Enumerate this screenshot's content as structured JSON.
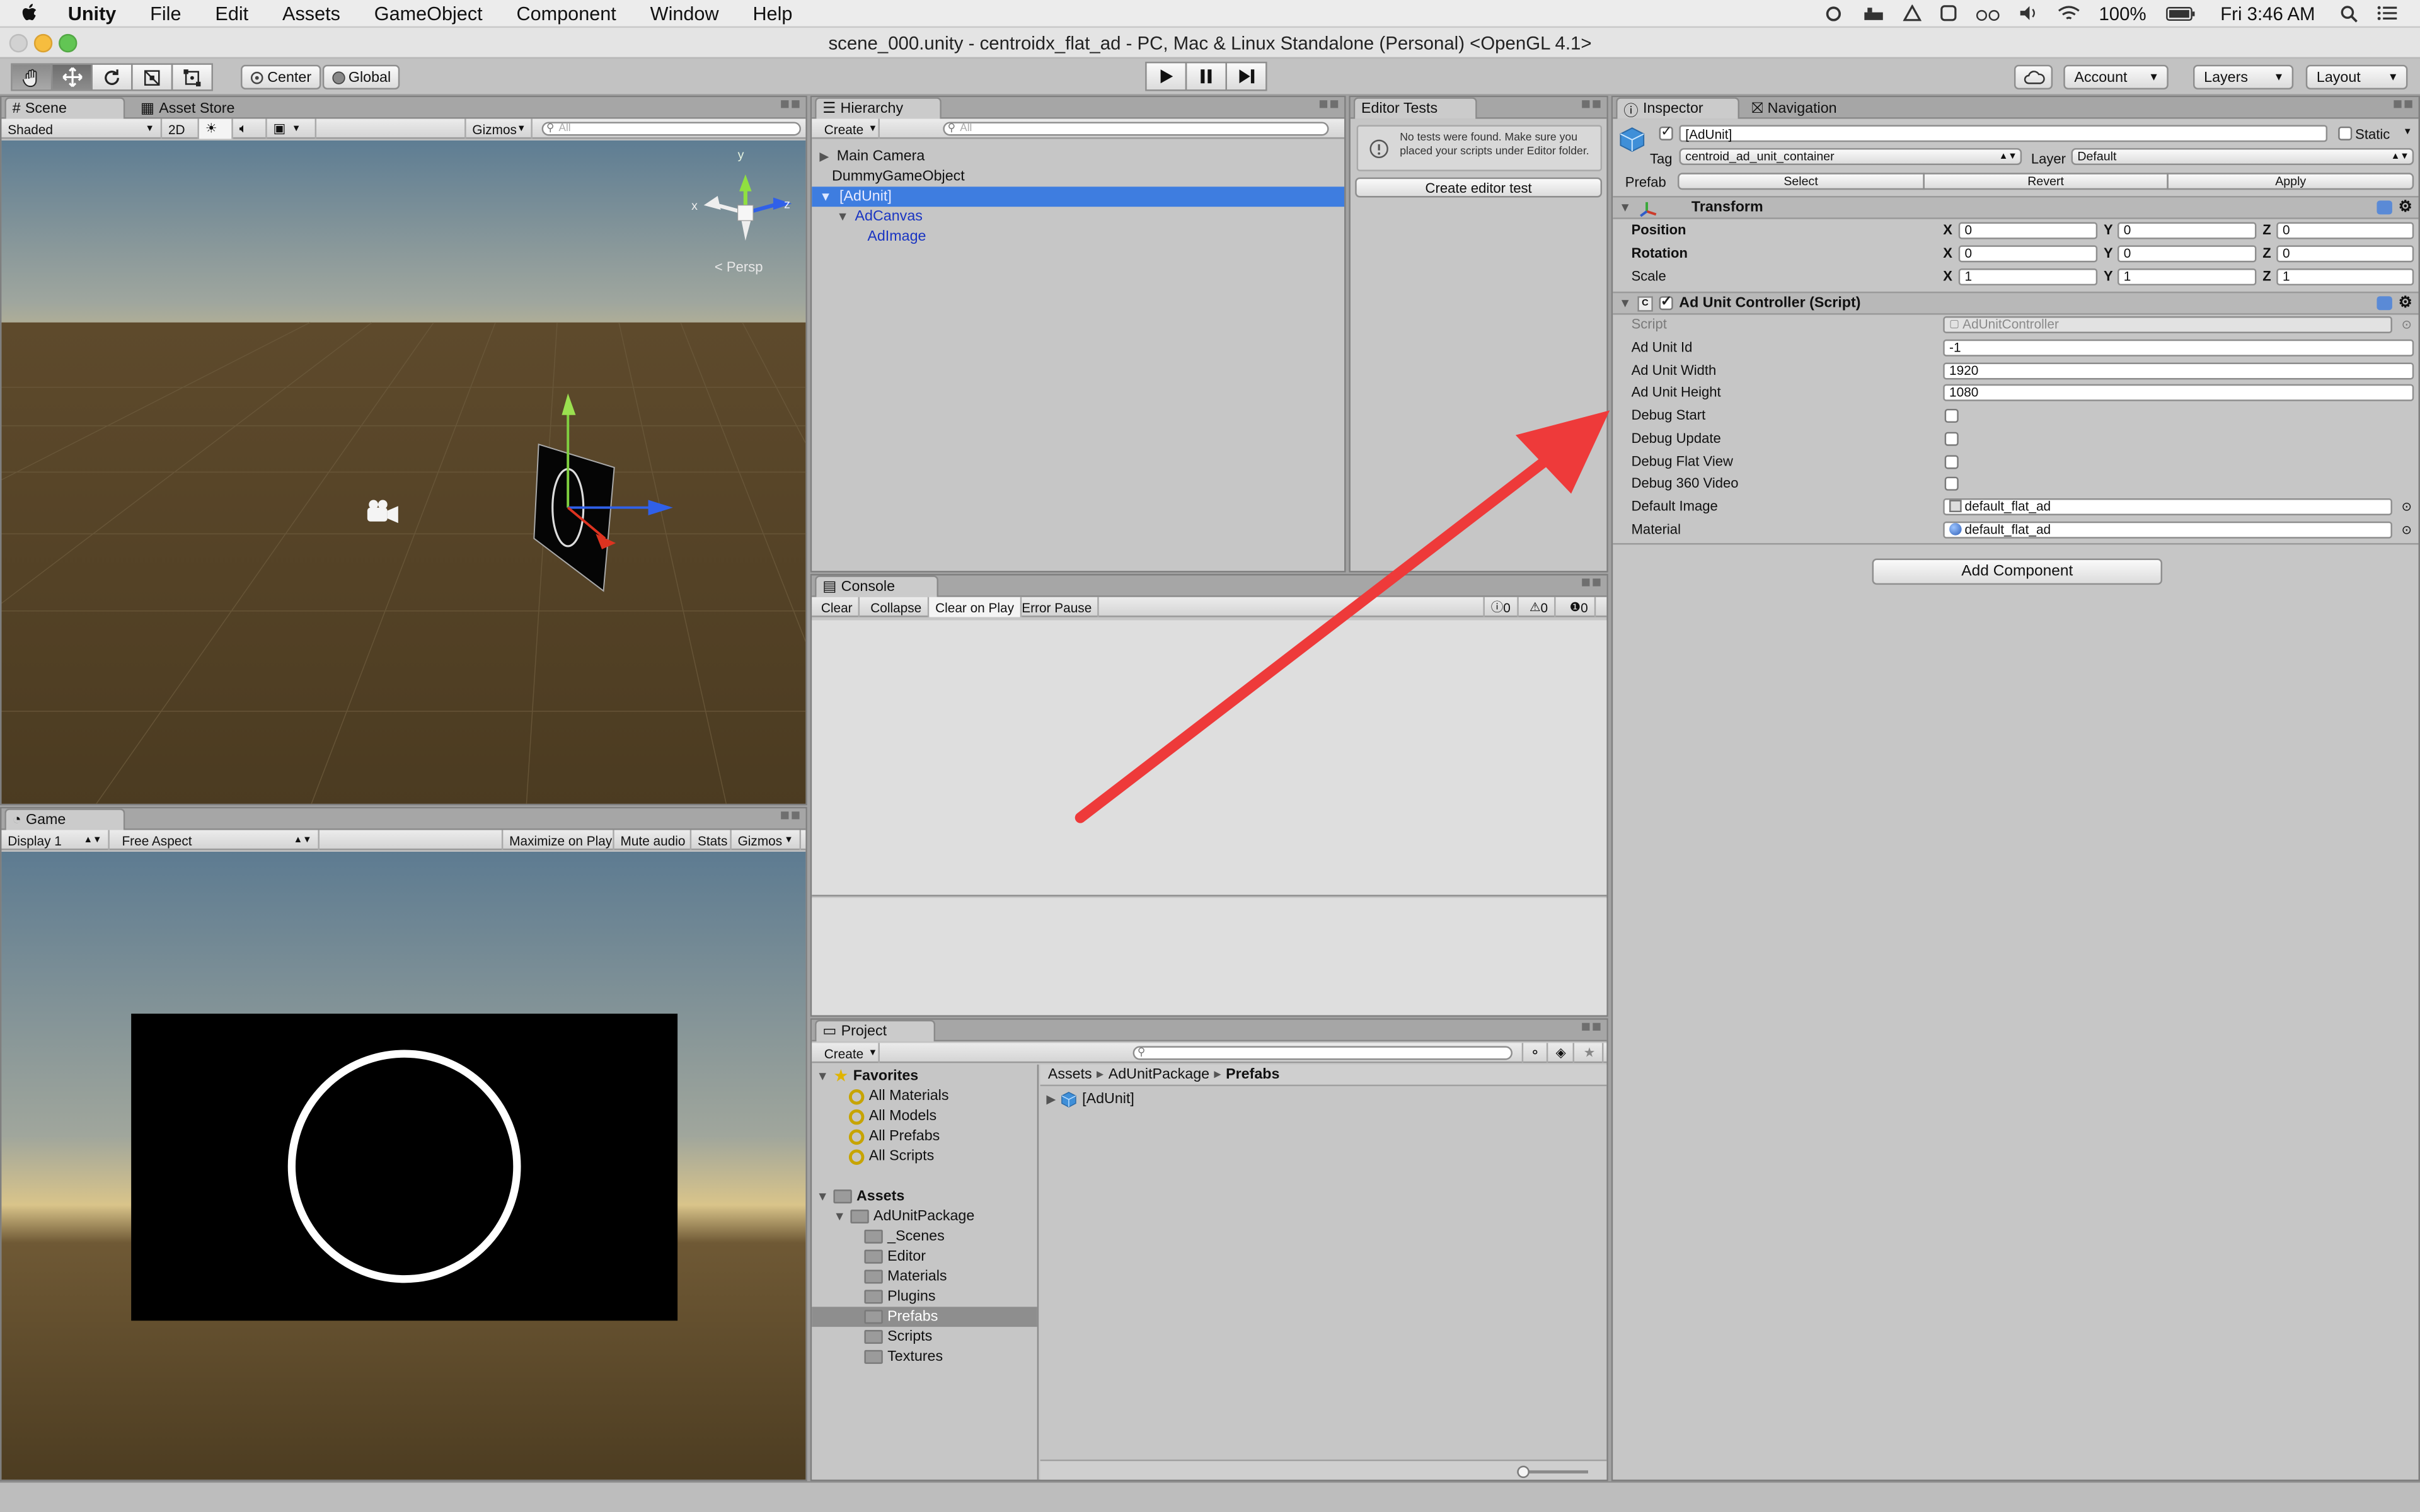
{
  "menubar": {
    "app_name": "Unity",
    "items": [
      "File",
      "Edit",
      "Assets",
      "GameObject",
      "Component",
      "Window",
      "Help"
    ],
    "battery": "100%",
    "clock": "Fri 3:46 AM"
  },
  "window": {
    "title": "scene_000.unity - centroidx_flat_ad - PC, Mac & Linux Standalone (Personal) <OpenGL 4.1>"
  },
  "toolbar": {
    "pivot": "Center",
    "space": "Global",
    "account": "Account",
    "layers": "Layers",
    "layout": "Layout"
  },
  "scene": {
    "tab": "Scene",
    "tab2": "Asset Store",
    "draw_mode": "Shaded",
    "mode_2d": "2D",
    "gizmos": "Gizmos",
    "search_placeholder": "All",
    "persp": "Persp",
    "axis_x": "x",
    "axis_y": "y",
    "axis_z": "z"
  },
  "game": {
    "tab": "Game",
    "display": "Display 1",
    "aspect": "Free Aspect",
    "maximize": "Maximize on Play",
    "mute": "Mute audio",
    "stats": "Stats",
    "gizmos": "Gizmos"
  },
  "hierarchy": {
    "tab": "Hierarchy",
    "create": "Create",
    "search_placeholder": "All",
    "items": [
      "Main Camera",
      "DummyGameObject",
      "[AdUnit]",
      "AdCanvas",
      "AdImage"
    ]
  },
  "editor_tests": {
    "tab": "Editor Tests",
    "message": "No tests were found. Make sure you placed your scripts under Editor folder.",
    "create_button": "Create editor test"
  },
  "console": {
    "tab": "Console",
    "clear": "Clear",
    "collapse": "Collapse",
    "clear_on_play": "Clear on Play",
    "error_pause": "Error Pause",
    "log_count": "0",
    "warn_count": "0",
    "error_count": "0"
  },
  "project": {
    "tab": "Project",
    "create": "Create",
    "favorites_label": "Favorites",
    "favorites": [
      "All Materials",
      "All Models",
      "All Prefabs",
      "All Scripts"
    ],
    "assets_label": "Assets",
    "package": "AdUnitPackage",
    "folders": [
      "_Scenes",
      "Editor",
      "Materials",
      "Plugins",
      "Prefabs",
      "Scripts",
      "Textures"
    ],
    "breadcrumb": [
      "Assets",
      "AdUnitPackage",
      "Prefabs"
    ],
    "files": [
      "[AdUnit]"
    ]
  },
  "inspector": {
    "tab": "Inspector",
    "tab2": "Navigation",
    "object_name": "[AdUnit]",
    "static_label": "Static",
    "tag_label": "Tag",
    "tag_value": "centroid_ad_unit_container",
    "layer_label": "Layer",
    "layer_value": "Default",
    "prefab_label": "Prefab",
    "prefab_select": "Select",
    "prefab_revert": "Revert",
    "prefab_apply": "Apply",
    "transform": {
      "title": "Transform",
      "position_label": "Position",
      "rotation_label": "Rotation",
      "scale_label": "Scale",
      "position": [
        "0",
        "0",
        "0"
      ],
      "rotation": [
        "0",
        "0",
        "0"
      ],
      "scale": [
        "1",
        "1",
        "1"
      ],
      "x": "X",
      "y": "Y",
      "z": "Z"
    },
    "script": {
      "title": "Ad Unit Controller (Script)",
      "script_label": "Script",
      "script_value": "AdUnitController",
      "ad_unit_id_label": "Ad Unit Id",
      "ad_unit_id": "-1",
      "width_label": "Ad Unit Width",
      "width": "1920",
      "height_label": "Ad Unit Height",
      "height": "1080",
      "debug_start_label": "Debug Start",
      "debug_update_label": "Debug Update",
      "debug_flat_label": "Debug Flat View",
      "debug_360_label": "Debug 360 Video",
      "default_image_label": "Default Image",
      "default_image": "default_flat_ad",
      "material_label": "Material",
      "material": "default_flat_ad"
    },
    "add_component": "Add Component"
  },
  "colors": {
    "selection": "#3e7de0",
    "arrow": "#ee3a3a",
    "sky_top": "#5e7d93",
    "ground": "#4b3b21"
  }
}
